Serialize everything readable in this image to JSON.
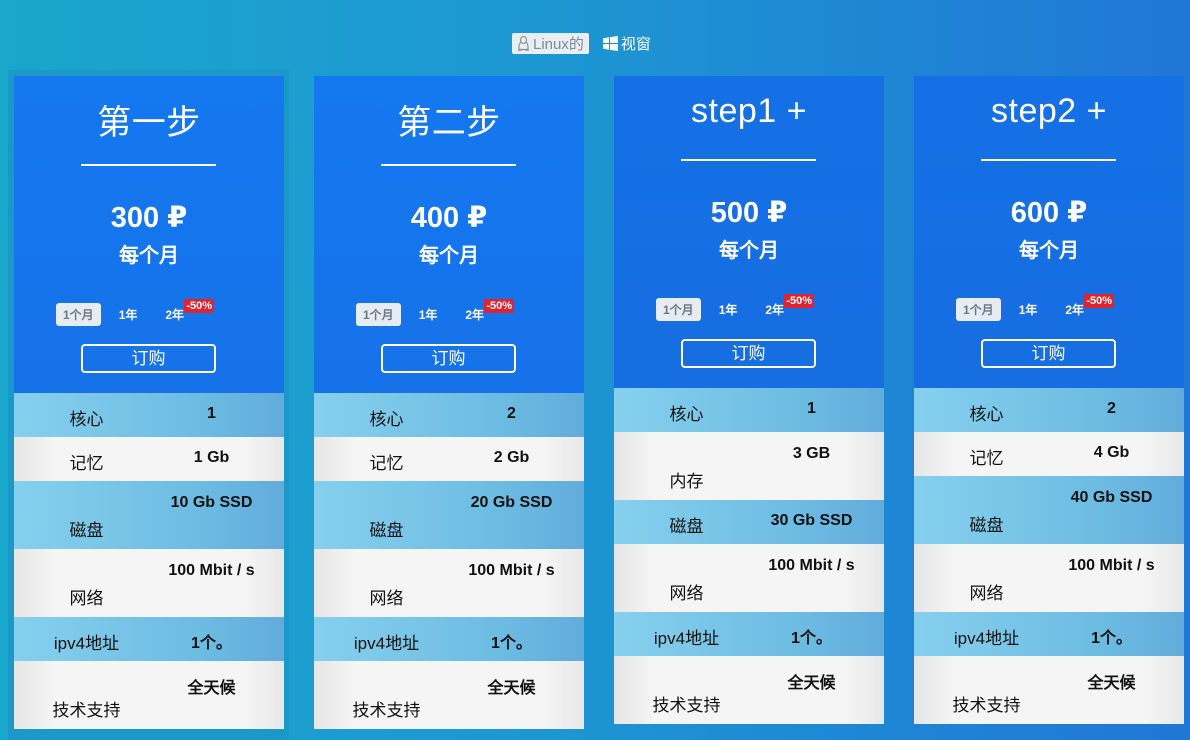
{
  "os_switch": {
    "linux": {
      "label": "Linux的",
      "icon": "linux-penguin-icon",
      "active": true
    },
    "windows": {
      "label": "视窗",
      "icon": "windows-logo-icon",
      "active": false
    }
  },
  "periods": {
    "month": "1个月",
    "year": "1年",
    "two_years": "2年",
    "discount_badge": "-50%"
  },
  "per_month": "每个月",
  "order_label": "订购",
  "plans": [
    {
      "title": "第一步",
      "price": "300 ₽",
      "selected": true,
      "specs": [
        {
          "label": "核心",
          "value": "1"
        },
        {
          "label": "记忆",
          "value": "1 Gb"
        },
        {
          "label": "磁盘",
          "value": "10 Gb SSD"
        },
        {
          "label": "网络",
          "value": "100 Mbit / s"
        },
        {
          "label": "ipv4地址",
          "value": "1个。"
        },
        {
          "label": "技术支持",
          "value": "全天候"
        }
      ]
    },
    {
      "title": "第二步",
      "price": "400 ₽",
      "selected": false,
      "specs": [
        {
          "label": "核心",
          "value": "2"
        },
        {
          "label": "记忆",
          "value": "2 Gb"
        },
        {
          "label": "磁盘",
          "value": "20 Gb SSD"
        },
        {
          "label": "网络",
          "value": "100 Mbit / s"
        },
        {
          "label": "ipv4地址",
          "value": "1个。"
        },
        {
          "label": "技术支持",
          "value": "全天候"
        }
      ]
    },
    {
      "title": "step1 +",
      "price": "500 ₽",
      "selected": false,
      "specs": [
        {
          "label": "核心",
          "value": "1"
        },
        {
          "label": "内存",
          "value": "3 GB"
        },
        {
          "label": "磁盘",
          "value": "30 Gb SSD"
        },
        {
          "label": "网络",
          "value": "100 Mbit / s"
        },
        {
          "label": "ipv4地址",
          "value": "1个。"
        },
        {
          "label": "技术支持",
          "value": "全天候"
        }
      ]
    },
    {
      "title": "step2 +",
      "price": "600 ₽",
      "selected": false,
      "specs": [
        {
          "label": "核心",
          "value": "2"
        },
        {
          "label": "记忆",
          "value": "4 Gb"
        },
        {
          "label": "磁盘",
          "value": "40 Gb SSD"
        },
        {
          "label": "网络",
          "value": "100 Mbit / s"
        },
        {
          "label": "ipv4地址",
          "value": "1个。"
        },
        {
          "label": "技术支持",
          "value": "全天候"
        }
      ]
    }
  ],
  "colors": {
    "accent_blue": "#1478f0",
    "discount_red": "#e0242f",
    "selected_frame": "#1a99c9"
  }
}
